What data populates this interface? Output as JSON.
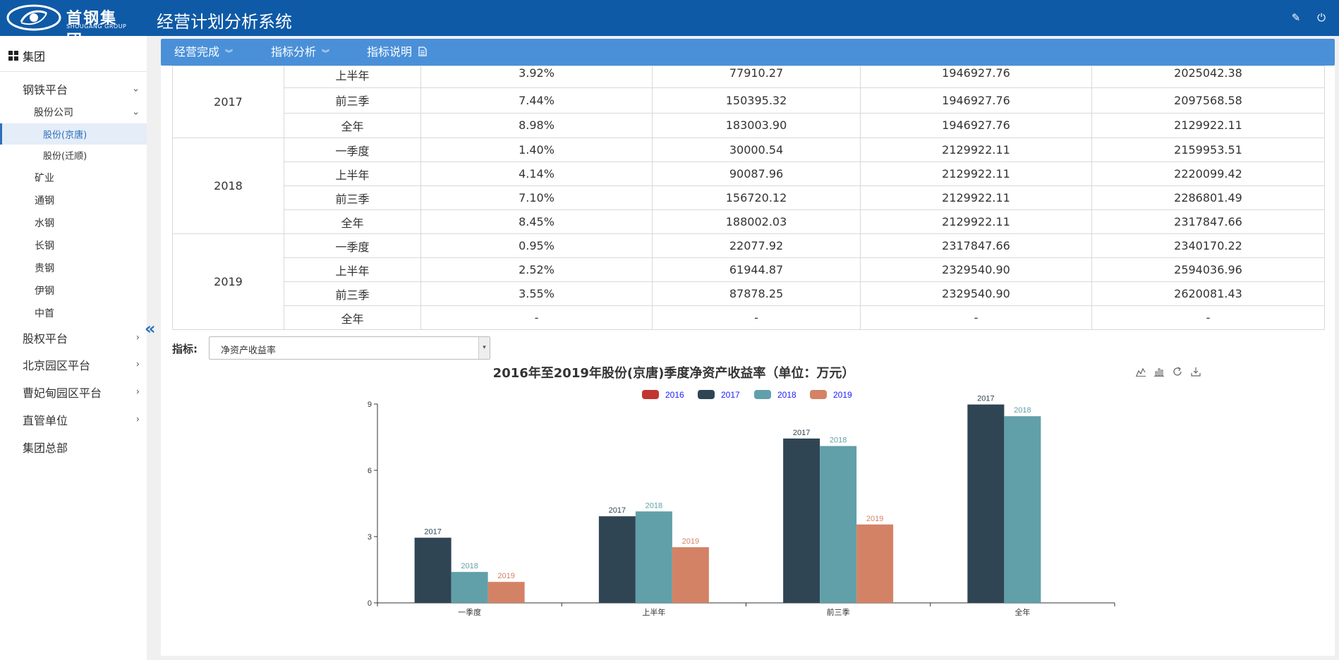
{
  "header": {
    "logo_cn": "首钢集团",
    "logo_en": "SHOUGANG GROUP",
    "app_title": "经营计划分析系统",
    "edit_icon": "edit-icon",
    "power_icon": "power-icon"
  },
  "sidebar": {
    "root_label": "集团",
    "items": [
      {
        "label": "钢铁平台",
        "level": 1,
        "expanded": true
      },
      {
        "label": "股份公司",
        "level": 2,
        "expanded": true
      },
      {
        "label": "股份(京唐)",
        "level": 3,
        "active": true
      },
      {
        "label": "股份(迁顺)",
        "level": 3
      },
      {
        "label": "矿业",
        "level": 2
      },
      {
        "label": "通钢",
        "level": 2
      },
      {
        "label": "水钢",
        "level": 2
      },
      {
        "label": "长钢",
        "level": 2
      },
      {
        "label": "贵钢",
        "level": 2
      },
      {
        "label": "伊钢",
        "level": 2
      },
      {
        "label": "中首",
        "level": 2
      },
      {
        "label": "股权平台",
        "level": 1,
        "collapsed": true
      },
      {
        "label": "北京园区平台",
        "level": 1,
        "collapsed": true
      },
      {
        "label": "曹妃甸园区平台",
        "level": 1,
        "collapsed": true
      },
      {
        "label": "直管单位",
        "level": 1,
        "collapsed": true
      },
      {
        "label": "集团总部",
        "level": 1
      }
    ]
  },
  "menubar": {
    "items": [
      {
        "label": "经营完成",
        "icon": "chevron-double-down-icon"
      },
      {
        "label": "指标分析",
        "icon": "chevron-double-down-icon"
      },
      {
        "label": "指标说明",
        "icon": "document-icon"
      }
    ]
  },
  "table": {
    "groups": [
      {
        "year": "2017",
        "rows": [
          [
            "上半年",
            "3.92%",
            "77910.27",
            "1946927.76",
            "2025042.38"
          ],
          [
            "前三季",
            "7.44%",
            "150395.32",
            "1946927.76",
            "2097568.58"
          ],
          [
            "全年",
            "8.98%",
            "183003.90",
            "1946927.76",
            "2129922.11"
          ]
        ]
      },
      {
        "year": "2018",
        "rows": [
          [
            "一季度",
            "1.40%",
            "30000.54",
            "2129922.11",
            "2159953.51"
          ],
          [
            "上半年",
            "4.14%",
            "90087.96",
            "2129922.11",
            "2220099.42"
          ],
          [
            "前三季",
            "7.10%",
            "156720.12",
            "2129922.11",
            "2286801.49"
          ],
          [
            "全年",
            "8.45%",
            "188002.03",
            "2129922.11",
            "2317847.66"
          ]
        ]
      },
      {
        "year": "2019",
        "rows": [
          [
            "一季度",
            "0.95%",
            "22077.92",
            "2317847.66",
            "2340170.22"
          ],
          [
            "上半年",
            "2.52%",
            "61944.87",
            "2329540.90",
            "2594036.96"
          ],
          [
            "前三季",
            "3.55%",
            "87878.25",
            "2329540.90",
            "2620081.43"
          ],
          [
            "全年",
            "-",
            "-",
            "-",
            "-"
          ]
        ]
      }
    ]
  },
  "indicator": {
    "label": "指标:",
    "selected": "净资产收益率"
  },
  "toolbox": [
    "line-chart-icon",
    "bar-chart-icon",
    "refresh-icon",
    "download-icon"
  ],
  "chart_data": {
    "type": "bar",
    "title": "2016年至2019年股份(京唐)季度净资产收益率（单位：万元）",
    "categories": [
      "一季度",
      "上半年",
      "前三季",
      "全年"
    ],
    "series": [
      {
        "name": "2016",
        "color": "#c23531",
        "values": [
          null,
          null,
          null,
          null
        ]
      },
      {
        "name": "2017",
        "color": "#2f4554",
        "values": [
          2.95,
          3.92,
          7.44,
          8.98
        ]
      },
      {
        "name": "2018",
        "color": "#61a0a8",
        "values": [
          1.4,
          4.14,
          7.1,
          8.45
        ]
      },
      {
        "name": "2019",
        "color": "#d48265",
        "values": [
          0.95,
          2.52,
          3.55,
          null
        ]
      }
    ],
    "ylim": [
      0,
      9
    ],
    "yticks": [
      0,
      3,
      6,
      9
    ],
    "legend_position": "top-center",
    "grid": false
  }
}
